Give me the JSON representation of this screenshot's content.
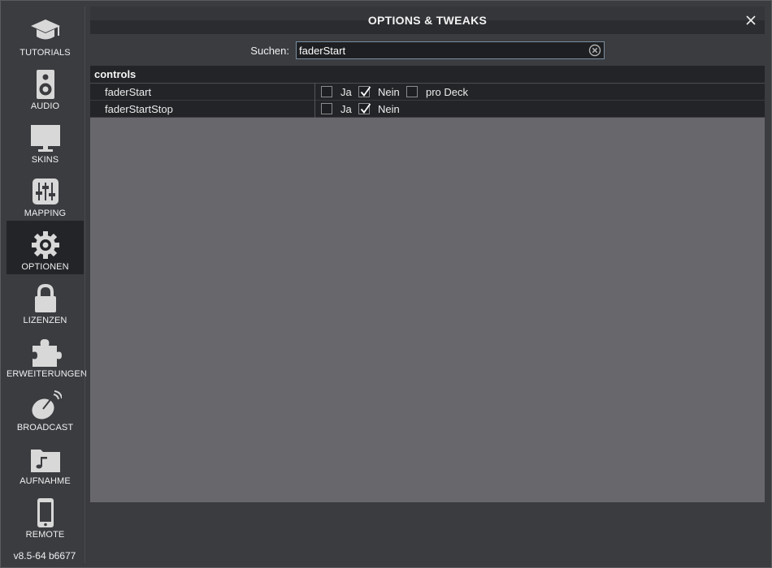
{
  "sidebar": {
    "items": [
      {
        "label": "TUTORIALS",
        "icon": "graduation-cap-icon",
        "active": false
      },
      {
        "label": "AUDIO",
        "icon": "speaker-icon",
        "active": false
      },
      {
        "label": "SKINS",
        "icon": "monitor-icon",
        "active": false
      },
      {
        "label": "MAPPING",
        "icon": "sliders-icon",
        "active": false
      },
      {
        "label": "OPTIONEN",
        "icon": "gear-icon",
        "active": true
      },
      {
        "label": "LIZENZEN",
        "icon": "lock-icon",
        "active": false
      },
      {
        "label": "ERWEITERUNGEN",
        "icon": "puzzle-icon",
        "active": false
      },
      {
        "label": "BROADCAST",
        "icon": "satellite-dish-icon",
        "active": false
      },
      {
        "label": "AUFNAHME",
        "icon": "music-folder-icon",
        "active": false
      },
      {
        "label": "REMOTE",
        "icon": "phone-icon",
        "active": false
      }
    ],
    "version": "v8.5-64 b6677"
  },
  "window": {
    "title": "OPTIONS & TWEAKS",
    "close_icon": "close-icon"
  },
  "search": {
    "label": "Suchen:",
    "value": "faderStart",
    "clear_icon": "clear-circle-icon"
  },
  "section": {
    "title": "controls",
    "rows": [
      {
        "name": "faderStart",
        "options": [
          {
            "label": "Ja",
            "checked": false
          },
          {
            "label": "Nein",
            "checked": true
          },
          {
            "label": "pro Deck",
            "checked": false
          }
        ]
      },
      {
        "name": "faderStartStop",
        "options": [
          {
            "label": "Ja",
            "checked": false
          },
          {
            "label": "Nein",
            "checked": true
          }
        ]
      }
    ]
  },
  "colors": {
    "background": "#3b3c40",
    "panel": "#68676c",
    "row": "#232427",
    "accent_border": "#7a8fa0"
  }
}
